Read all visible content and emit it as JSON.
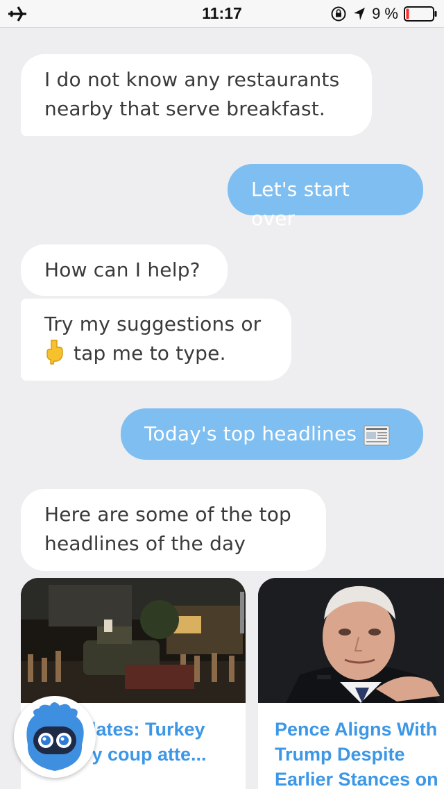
{
  "status_bar": {
    "time": "11:17",
    "battery_percent": "9 %",
    "battery_level": 0.09,
    "icons": [
      "airplane-icon",
      "orientation-lock-icon",
      "location-arrow-icon",
      "battery-icon"
    ]
  },
  "messages": [
    {
      "sender": "bot",
      "text": "I do not know any restaurants nearby that serve breakfast."
    },
    {
      "sender": "user",
      "text": "Let's start over"
    },
    {
      "sender": "bot",
      "text": "How can I help?"
    },
    {
      "sender": "bot",
      "text": "Try my suggestions or",
      "line2": "tap me to type.",
      "icon": "pointing-down-hand-icon"
    },
    {
      "sender": "user",
      "text": "Today's top headlines",
      "icon": "newspaper-icon"
    },
    {
      "sender": "bot",
      "text": "Here are some of the top headlines of the day"
    }
  ],
  "cards": [
    {
      "title": "Updates: Turkey military coup atte...",
      "visible_title": "dates: Turkey\nry coup atte...",
      "image": "night-street-tanks-crowd-photo"
    },
    {
      "title": "Pence Aligns With Trump Despite Earlier Stances on",
      "image": "man-in-suit-portrait-photo"
    }
  ],
  "colors": {
    "background": "#eeeef0",
    "bot_bubble": "#ffffff",
    "user_bubble": "#7ebef1",
    "card_title": "#3c97e6",
    "avatar_blue": "#3f8fe0"
  }
}
